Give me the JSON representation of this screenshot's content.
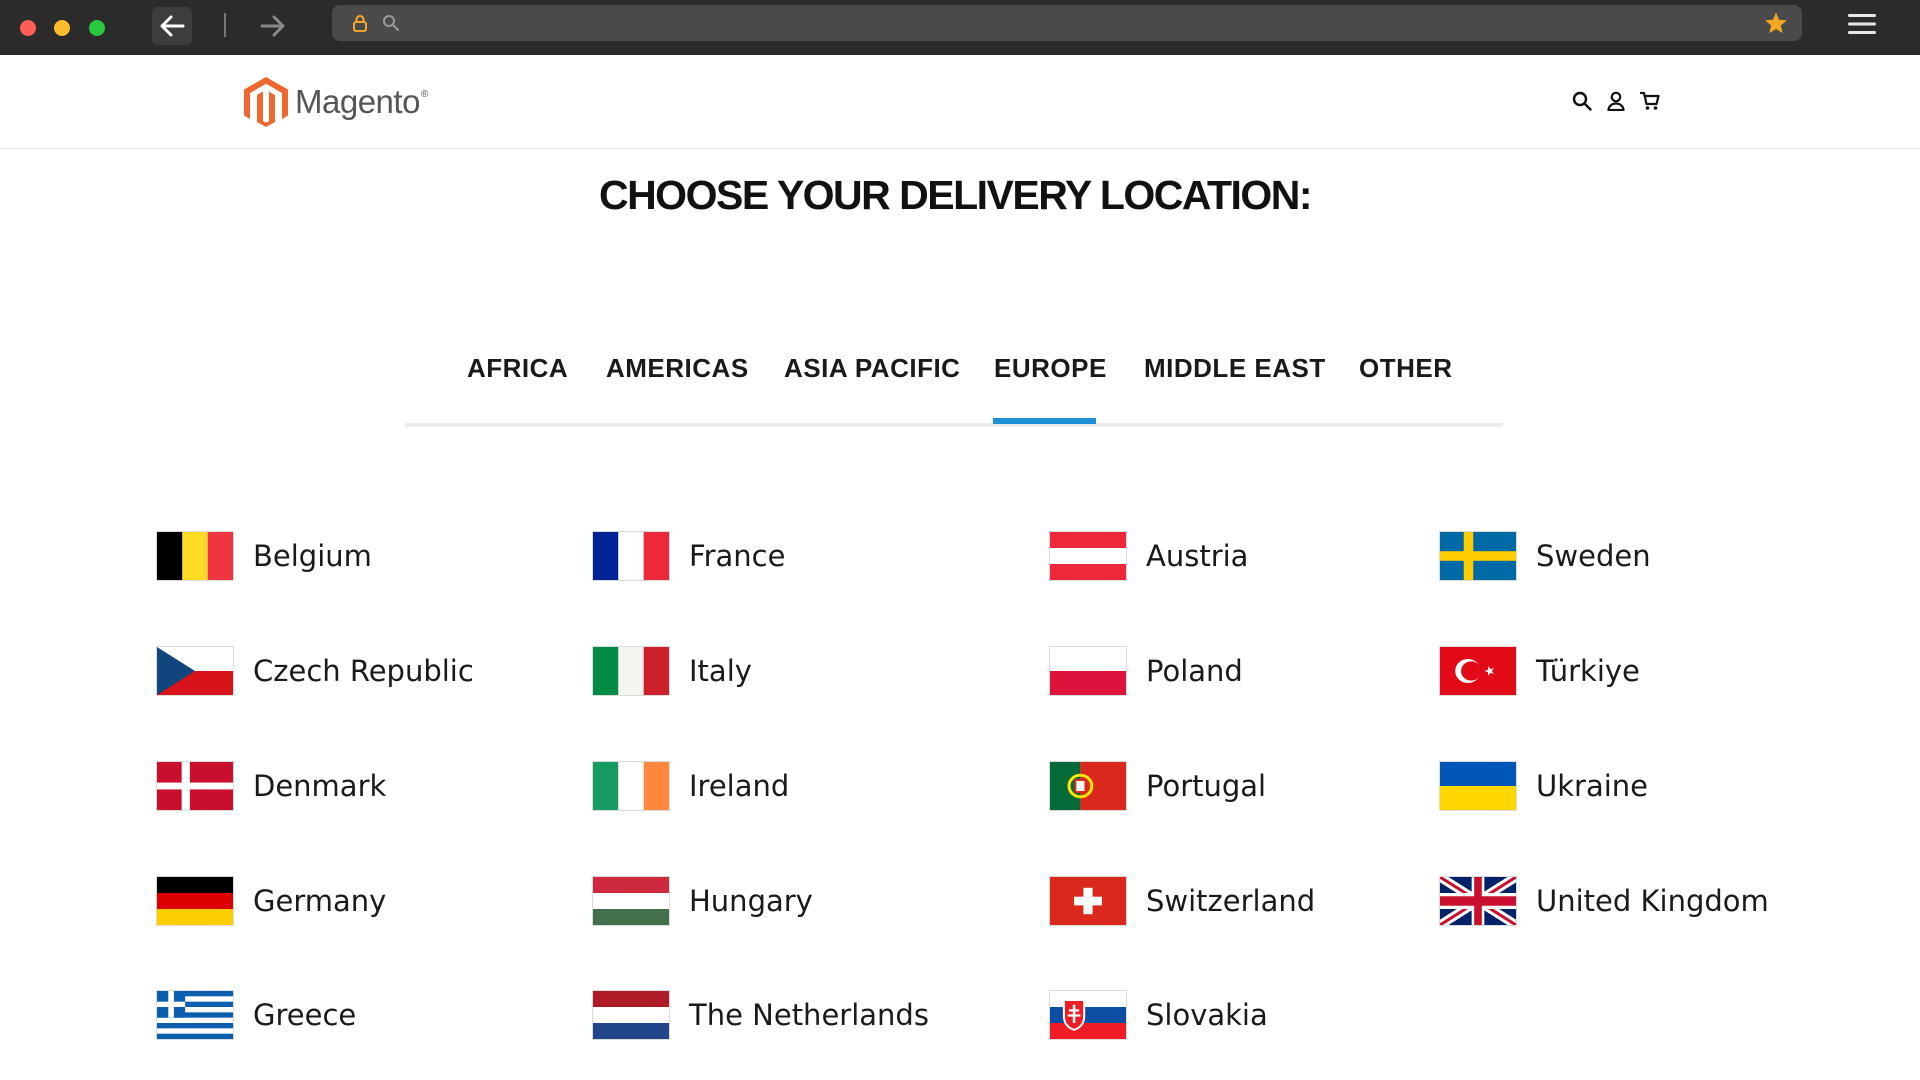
{
  "browser": {
    "icons": {
      "back": "arrow-left-icon",
      "forward": "arrow-right-icon",
      "lock": "lock-icon",
      "search": "search-icon",
      "bookmark": "star-icon",
      "menu": "hamburger-icon"
    },
    "colors": {
      "lock": "#f5a623",
      "star": "#f5a623"
    }
  },
  "header": {
    "logo_text": "Magento",
    "logo_mark": "®",
    "icons": [
      "search-icon",
      "user-icon",
      "cart-icon"
    ]
  },
  "page": {
    "title": "CHOOSE YOUR DELIVERY LOCATION:"
  },
  "tabs": {
    "items": [
      {
        "label": "AFRICA"
      },
      {
        "label": "AMERICAS"
      },
      {
        "label": "ASIA PACIFIC"
      },
      {
        "label": "EUROPE"
      },
      {
        "label": "MIDDLE EAST"
      },
      {
        "label": "OTHER"
      }
    ],
    "active": "EUROPE",
    "accent_color": "#1e90d6"
  },
  "countries": {
    "col1": [
      {
        "name": "Belgium",
        "flag": "belgium-flag-icon"
      },
      {
        "name": "Czech Republic",
        "flag": "czech-flag-icon"
      },
      {
        "name": "Denmark",
        "flag": "denmark-flag-icon"
      },
      {
        "name": "Germany",
        "flag": "germany-flag-icon"
      },
      {
        "name": "Greece",
        "flag": "greece-flag-icon"
      }
    ],
    "col2": [
      {
        "name": "France",
        "flag": "france-flag-icon"
      },
      {
        "name": "Italy",
        "flag": "italy-flag-icon"
      },
      {
        "name": "Ireland",
        "flag": "ireland-flag-icon"
      },
      {
        "name": "Hungary",
        "flag": "hungary-flag-icon"
      },
      {
        "name": "The Netherlands",
        "flag": "netherlands-flag-icon"
      }
    ],
    "col3": [
      {
        "name": "Austria",
        "flag": "austria-flag-icon"
      },
      {
        "name": "Poland",
        "flag": "poland-flag-icon"
      },
      {
        "name": "Portugal",
        "flag": "portugal-flag-icon"
      },
      {
        "name": "Switzerland",
        "flag": "switzerland-flag-icon"
      },
      {
        "name": "Slovakia",
        "flag": "slovakia-flag-icon"
      }
    ],
    "col4": [
      {
        "name": "Sweden",
        "flag": "sweden-flag-icon"
      },
      {
        "name": "Türkiye",
        "flag": "turkey-flag-icon"
      },
      {
        "name": "Ukraine",
        "flag": "ukraine-flag-icon"
      },
      {
        "name": "United Kingdom",
        "flag": "uk-flag-icon"
      }
    ]
  }
}
